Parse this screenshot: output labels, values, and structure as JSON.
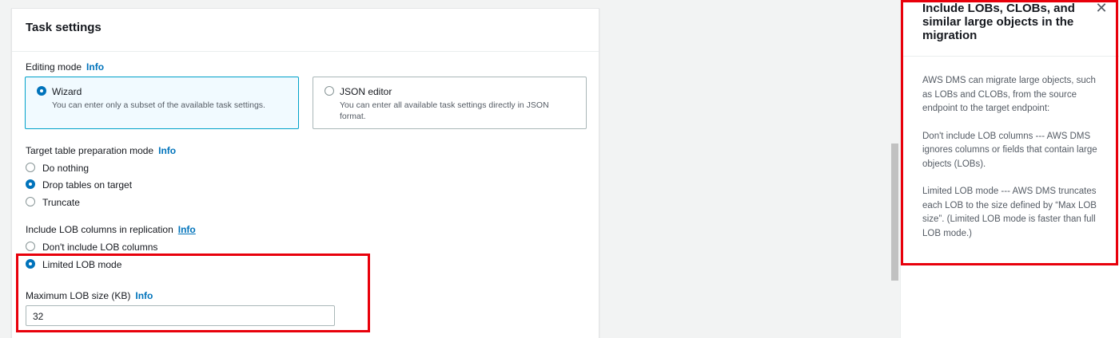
{
  "panel": {
    "title": "Task settings",
    "info_label": "Info",
    "editing_mode": {
      "label": "Editing mode",
      "options": [
        {
          "title": "Wizard",
          "description": "You can enter only a subset of the available task settings.",
          "selected": true
        },
        {
          "title": "JSON editor",
          "description": "You can enter all available task settings directly in JSON format.",
          "selected": false
        }
      ]
    },
    "target_prep": {
      "label": "Target table preparation mode",
      "options": [
        "Do nothing",
        "Drop tables on target",
        "Truncate"
      ],
      "selected": "Drop tables on target"
    },
    "lob": {
      "label": "Include LOB columns in replication",
      "options": [
        "Don't include LOB columns",
        "Limited LOB mode"
      ],
      "selected": "Limited LOB mode"
    },
    "max_lob": {
      "label": "Maximum LOB size (KB)",
      "value": "32"
    }
  },
  "help": {
    "title": "Include LOBs, CLOBs, and similar large objects in the migration",
    "paragraphs": [
      "AWS DMS can migrate large objects, such as LOBs and CLOBs, from the source endpoint to the target endpoint:",
      "Don't include LOB columns --- AWS DMS ignores columns or fields that contain large objects (LOBs).",
      "Limited LOB mode --- AWS DMS truncates each LOB to the size defined by “Max LOB size”.  (Limited LOB mode is faster than full LOB mode.)"
    ],
    "close_glyph": "✕"
  },
  "colors": {
    "accent": "#0073bb",
    "highlight": "#e8000b",
    "tile_selected_border": "#00a1c9"
  }
}
